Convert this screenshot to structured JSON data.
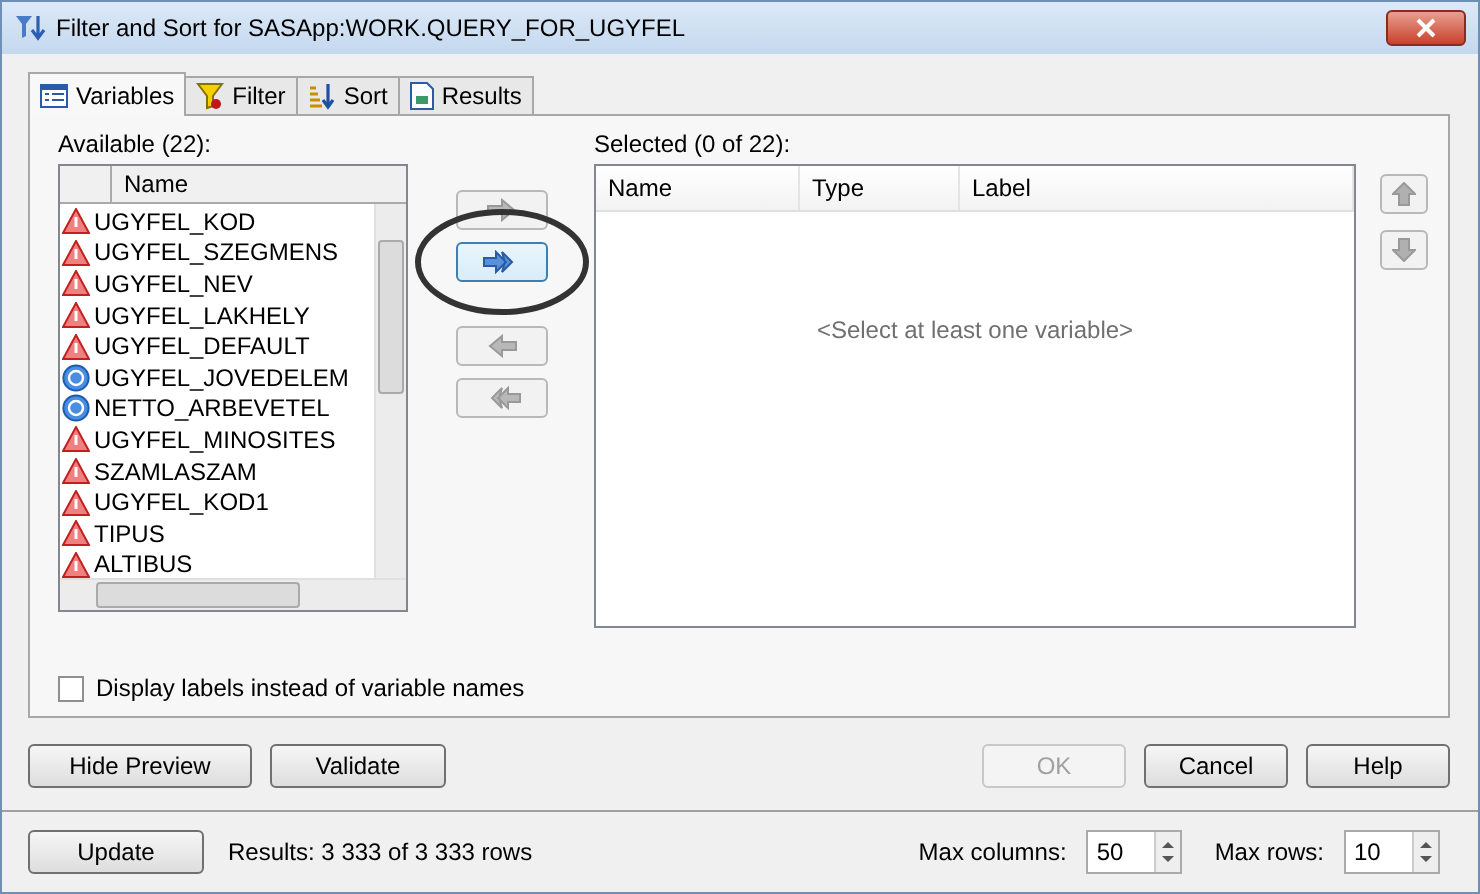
{
  "window": {
    "title": "Filter and Sort for SASApp:WORK.QUERY_FOR_UGYFEL"
  },
  "tabs": [
    {
      "label": "Variables",
      "selected": true,
      "kind": "list"
    },
    {
      "label": "Filter",
      "selected": false,
      "kind": "filter"
    },
    {
      "label": "Sort",
      "selected": false,
      "kind": "sort"
    },
    {
      "label": "Results",
      "selected": false,
      "kind": "results"
    }
  ],
  "available": {
    "label": "Available (22):",
    "column": "Name",
    "items": [
      {
        "name": "UGYFEL_KOD",
        "kind": "char"
      },
      {
        "name": "UGYFEL_SZEGMENS",
        "kind": "char"
      },
      {
        "name": "UGYFEL_NEV",
        "kind": "char"
      },
      {
        "name": "UGYFEL_LAKHELY",
        "kind": "char"
      },
      {
        "name": "UGYFEL_DEFAULT",
        "kind": "char"
      },
      {
        "name": "UGYFEL_JOVEDELEM",
        "kind": "num"
      },
      {
        "name": "NETTO_ARBEVETEL",
        "kind": "num"
      },
      {
        "name": "UGYFEL_MINOSITES",
        "kind": "char"
      },
      {
        "name": "SZAMLASZAM",
        "kind": "char"
      },
      {
        "name": "UGYFEL_KOD1",
        "kind": "char"
      },
      {
        "name": "TIPUS",
        "kind": "char"
      },
      {
        "name": "ALTIBUS",
        "kind": "char"
      }
    ]
  },
  "move_buttons": [
    {
      "kind": "add",
      "disabled": true,
      "circled": false
    },
    {
      "kind": "add_all",
      "disabled": false,
      "circled": true
    },
    {
      "kind": "remove",
      "disabled": true,
      "circled": false
    },
    {
      "kind": "remove_all",
      "disabled": true,
      "circled": false
    }
  ],
  "selected": {
    "label": "Selected (0 of 22):",
    "columns": [
      "Name",
      "Type",
      "Label"
    ],
    "empty_message": "<Select at least one variable>"
  },
  "order_buttons": [
    {
      "kind": "up",
      "disabled": true
    },
    {
      "kind": "down",
      "disabled": true
    }
  ],
  "display_labels": {
    "label": "Display labels instead of variable names",
    "checked": false
  },
  "left_buttons": [
    {
      "label": "Hide Preview",
      "disabled": false
    },
    {
      "label": "Validate",
      "disabled": false
    }
  ],
  "right_buttons": [
    {
      "label": "OK",
      "disabled": true
    },
    {
      "label": "Cancel",
      "disabled": false
    },
    {
      "label": "Help",
      "disabled": false
    }
  ],
  "preview": {
    "update_button": "Update",
    "results": "Results:  3 333 of 3 333 rows",
    "max_columns_label": "Max columns:",
    "max_columns": "50",
    "max_rows_label": "Max rows:",
    "max_rows": "10"
  }
}
